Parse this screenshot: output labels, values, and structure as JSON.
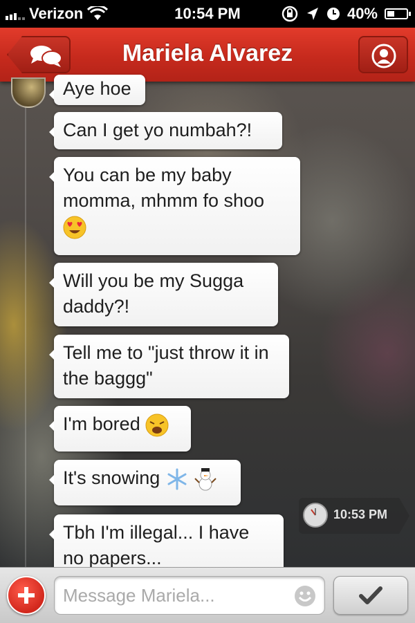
{
  "status_bar": {
    "carrier": "Verizon",
    "time": "10:54 PM",
    "battery": "40%",
    "battery_level": 0.4
  },
  "nav": {
    "title": "Mariela Alvarez",
    "back_icon": "chat-bubbles-icon",
    "profile_icon": "profile-icon"
  },
  "messages": [
    {
      "text": "Aye hoe"
    },
    {
      "text": "Can I get yo numbah?!"
    },
    {
      "text": "You can be my baby momma, mhmm fo shoo"
    },
    {
      "text": "Will you be my Sugga daddy?!"
    },
    {
      "text": "Tell me to \"just throw it in the baggg\""
    },
    {
      "text": "I'm bored"
    },
    {
      "text": "It's snowing"
    },
    {
      "text": "Tbh I'm illegal... I have no papers..."
    }
  ],
  "timestamp": "10:53 PM",
  "input": {
    "placeholder": "Message Mariela..."
  },
  "colors": {
    "nav_red": "#c62a1d",
    "bubble": "#ffffff"
  }
}
